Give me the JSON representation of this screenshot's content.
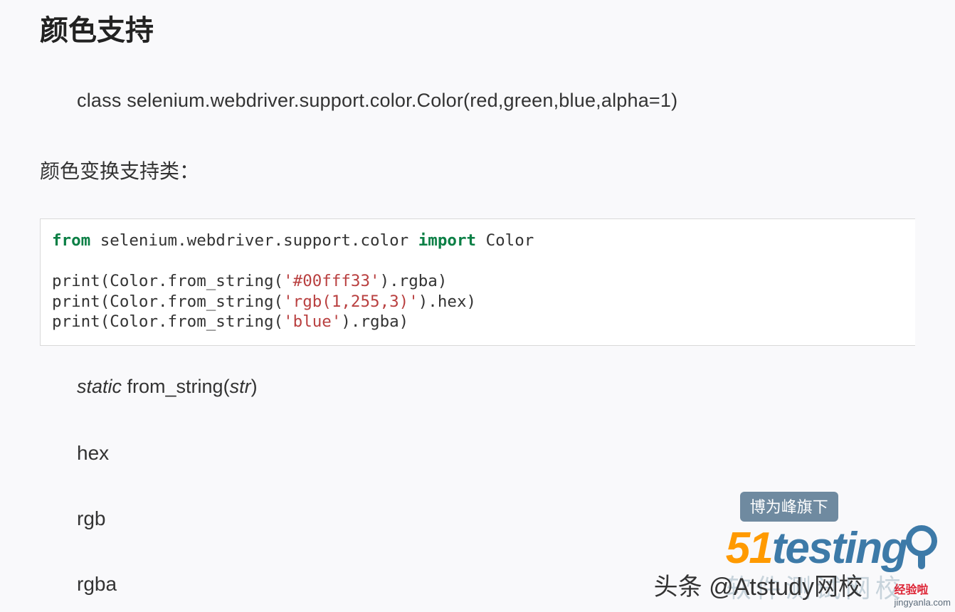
{
  "heading": "颜色支持",
  "class_signature": "class selenium.webdriver.support.color.Color(red,green,blue,alpha=1)",
  "subtitle": "颜色变换支持类：",
  "code": {
    "l1_pre": "from",
    "l1_mid": " selenium.webdriver.support.color ",
    "l1_kw2": "import",
    "l1_end": " Color",
    "l3_a": "print(Color.from_string(",
    "l3_s": "'#00fff33'",
    "l3_b": ").rgba)",
    "l4_a": "print(Color.from_string(",
    "l4_s": "'rgb(1,255,3)'",
    "l4_b": ").hex)",
    "l5_a": "print(Color.from_string(",
    "l5_s": "'blue'",
    "l5_b": ").rgba)"
  },
  "method": {
    "static": "static",
    "name": " from_string(",
    "param": "str",
    "close": ")"
  },
  "props": {
    "hex": "hex",
    "rgb": "rgb",
    "rgba": "rgba"
  },
  "watermark": {
    "tag": "博为峰旗下",
    "fiveone": "51",
    "testing": "testing",
    "subtitle": "软件测试网校",
    "overlay": "头条 @Atstudy网校",
    "brand_small": "经验啦",
    "domain_small": "jingyanla.com"
  }
}
